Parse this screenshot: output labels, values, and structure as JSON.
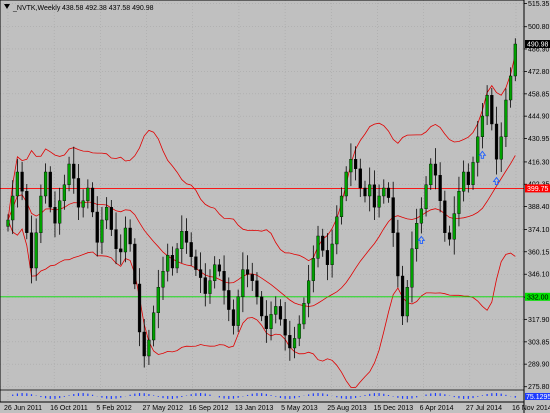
{
  "chart_data": {
    "type": "candlestick",
    "symbol": "_NVTK,Weekly",
    "header_values": "438.58 492.38 437.58 490.98",
    "background": "#c0c0c0",
    "colors": {
      "bull_body": "#00a000",
      "bear_body": "#000000",
      "wick": "#000000",
      "bands": "#e00000",
      "hline_red": "#ff0000",
      "hline_green": "#00e000",
      "price_box": "#000000",
      "arrow": "#1e5fff"
    },
    "ylim": [
      275.0,
      515.0
    ],
    "y_ticks": [
      "515.35",
      "500.80",
      "486.90",
      "472.80",
      "458.85",
      "444.90",
      "430.95",
      "416.30",
      "402.35",
      "388.40",
      "374.10",
      "360.15",
      "346.10",
      "331.80",
      "317.90",
      "303.85",
      "289.90",
      "275.80"
    ],
    "x_labels": [
      "26 Jun 2011",
      "16 Oct 2011",
      "5 Feb 2012",
      "27 May 2012",
      "16 Sep 2012",
      "13 Jan 2013",
      "5 May 2013",
      "25 Aug 2013",
      "15 Dec 2013",
      "6 Apr 2014",
      "27 Jul 2014",
      "16 Nov 2014"
    ],
    "price_box_label": "490.98",
    "hline_red_value": 399.75,
    "hline_red_label": "399.75",
    "hline_green_value": 332.0,
    "hline_green_label": "332.00",
    "indicator_label": "CCI(14) 75.1295",
    "closes": [
      380,
      395,
      410,
      398,
      372,
      350,
      372,
      395,
      410,
      388,
      378,
      392,
      402,
      415,
      406,
      388,
      392,
      400,
      385,
      366,
      380,
      388,
      374,
      362,
      360,
      375,
      365,
      340,
      310,
      295,
      305,
      322,
      338,
      348,
      358,
      350,
      362,
      373,
      366,
      357,
      349,
      344,
      334,
      342,
      352,
      348,
      336,
      324,
      314,
      332,
      349,
      346,
      342,
      332,
      320,
      312,
      321,
      326,
      318,
      308,
      300,
      306,
      315,
      328,
      342,
      356,
      370,
      361,
      352,
      365,
      382,
      395,
      410,
      418,
      412,
      400,
      395,
      402,
      388,
      395,
      400,
      394,
      372,
      345,
      320,
      338,
      362,
      378,
      387,
      402,
      415,
      408,
      392,
      372,
      368,
      384,
      398,
      410,
      402,
      416,
      432,
      445,
      458,
      440,
      418,
      432,
      455,
      470,
      490
    ]
  }
}
